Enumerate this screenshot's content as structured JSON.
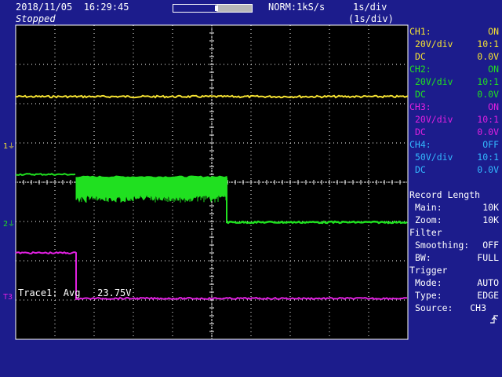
{
  "header": {
    "datetime": "2018/11/05  16:29:45",
    "status": "Stopped",
    "sample_info": "NORM:1kS/s",
    "timebase": "1s/div",
    "timebase_sub": "(1s/div)",
    "record_bar_fill": 0.55
  },
  "markers": {
    "ch1": "1",
    "ch2": "2",
    "ch3": "3",
    "trigger": "T"
  },
  "trace_readout": "Trace1: Avg   23.75V",
  "channels": [
    {
      "name": "CH1:",
      "state": "ON",
      "scale": "20V/div",
      "probe": "10:1",
      "coupling": "DC",
      "offset": "0.0V",
      "color": "#f5e232"
    },
    {
      "name": "CH2:",
      "state": "ON",
      "scale": "20V/div",
      "probe": "10:1",
      "coupling": "DC",
      "offset": "0.0V",
      "color": "#20e020"
    },
    {
      "name": "CH3:",
      "state": "ON",
      "scale": "20V/div",
      "probe": "10:1",
      "coupling": "DC",
      "offset": "0.0V",
      "color": "#e020e0"
    },
    {
      "name": "CH4:",
      "state": "OFF",
      "scale": "50V/div",
      "probe": "10:1",
      "coupling": "DC",
      "offset": "0.0V",
      "color": "#33b8ff"
    }
  ],
  "record_length": {
    "title": "Record Length",
    "main_label": "Main:",
    "main_value": "10K",
    "zoom_label": "Zoom:",
    "zoom_value": "10K"
  },
  "filter": {
    "title": "Filter",
    "smoothing_label": "Smoothing:",
    "smoothing_value": "OFF",
    "bw_label": "BW:",
    "bw_value": "FULL"
  },
  "trigger": {
    "title": "Trigger",
    "mode_label": "Mode:",
    "mode_value": "AUTO",
    "type_label": "Type:",
    "type_value": "EDGE",
    "source_label": "Source:",
    "source_value": "CH3",
    "slope_icon": "rising-edge-icon"
  },
  "colors": {
    "background": "#1c1c8c",
    "grid": "#ffffff",
    "screen": "#000000"
  }
}
